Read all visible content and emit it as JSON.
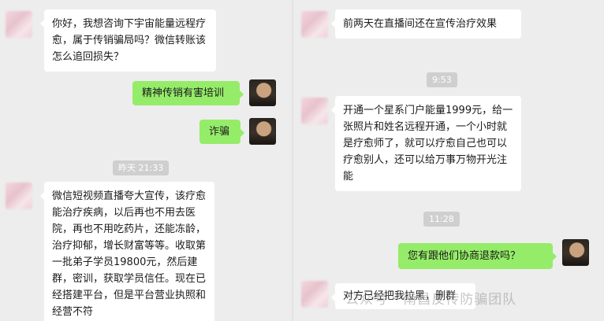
{
  "left_chat": {
    "msg1": "你好，我想咨询下宇宙能量远程疗愈，属于传销骗局吗？微信转账该怎么追回损失？",
    "msg2": "精神传销有害培训",
    "msg3": "诈骗",
    "time1": "昨天 21:33",
    "msg4": "微信短视频直播夸大宣传，该疗愈能治疗疾病，以后再也不用去医院，再也不用吃药片，还能冻龄，治疗抑郁，增长财富等等。收取第一批弟子学员19800元，然后建群，密训，获取学员信任。现在已经搭建平台，但是平台营业执照和经营不符"
  },
  "right_chat": {
    "msg1": "前两天在直播间还在宣传治疗效果",
    "time1": "9:53",
    "msg2": "开通一个星系门户能量1999元，给一张照片和姓名远程开通，一个小时就是疗愈师了，就可以疗愈自己也可以疗愈别人，还可以给万事万物开光注能",
    "time2": "11:28",
    "msg3": "您有跟他们协商退款吗？",
    "msg4": "对方已经把我拉黑，删群"
  },
  "watermark": "公众号 · 南昌反传防骗团队",
  "colors": {
    "background": "#ededed",
    "incoming": "#ffffff",
    "outgoing": "#95ec69",
    "time_pill": "#cfcfcf"
  }
}
